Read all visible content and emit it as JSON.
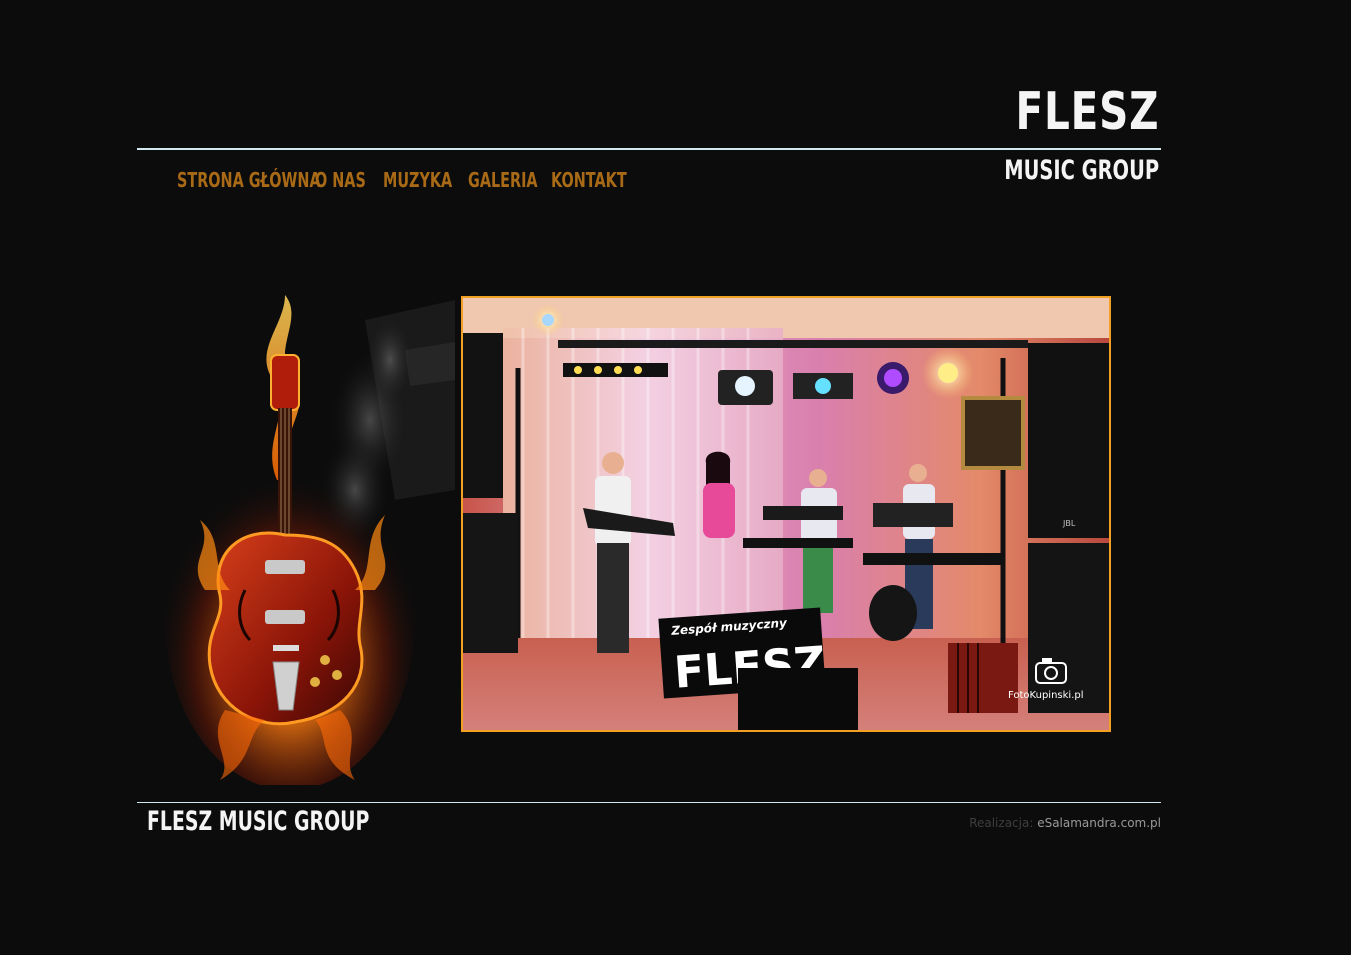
{
  "header": {
    "brand_title": "FLESZ",
    "brand_subtitle": "MUSIC GROUP"
  },
  "nav": {
    "items": [
      {
        "label": "STRONA GŁÓWNA"
      },
      {
        "label": "O NAS"
      },
      {
        "label": "MUZYKA"
      },
      {
        "label": "GALERIA"
      },
      {
        "label": "KONTAKT"
      }
    ]
  },
  "hero": {
    "banner_sign_line1": "Zespół muzyczny",
    "banner_sign_line2": "FLESZ",
    "photo_watermark": "FotoKupinski.pl"
  },
  "footer": {
    "title": "FLESZ MUSIC GROUP",
    "credit_label": "Realizacja: ",
    "credit_link": "eSalamandra.com.pl"
  },
  "colors": {
    "background": "#0c0c0c",
    "nav_text": "#a86a16",
    "divider": "#cfe9ef",
    "photo_border": "#f2a024",
    "brand_text": "#f4f4f4"
  }
}
